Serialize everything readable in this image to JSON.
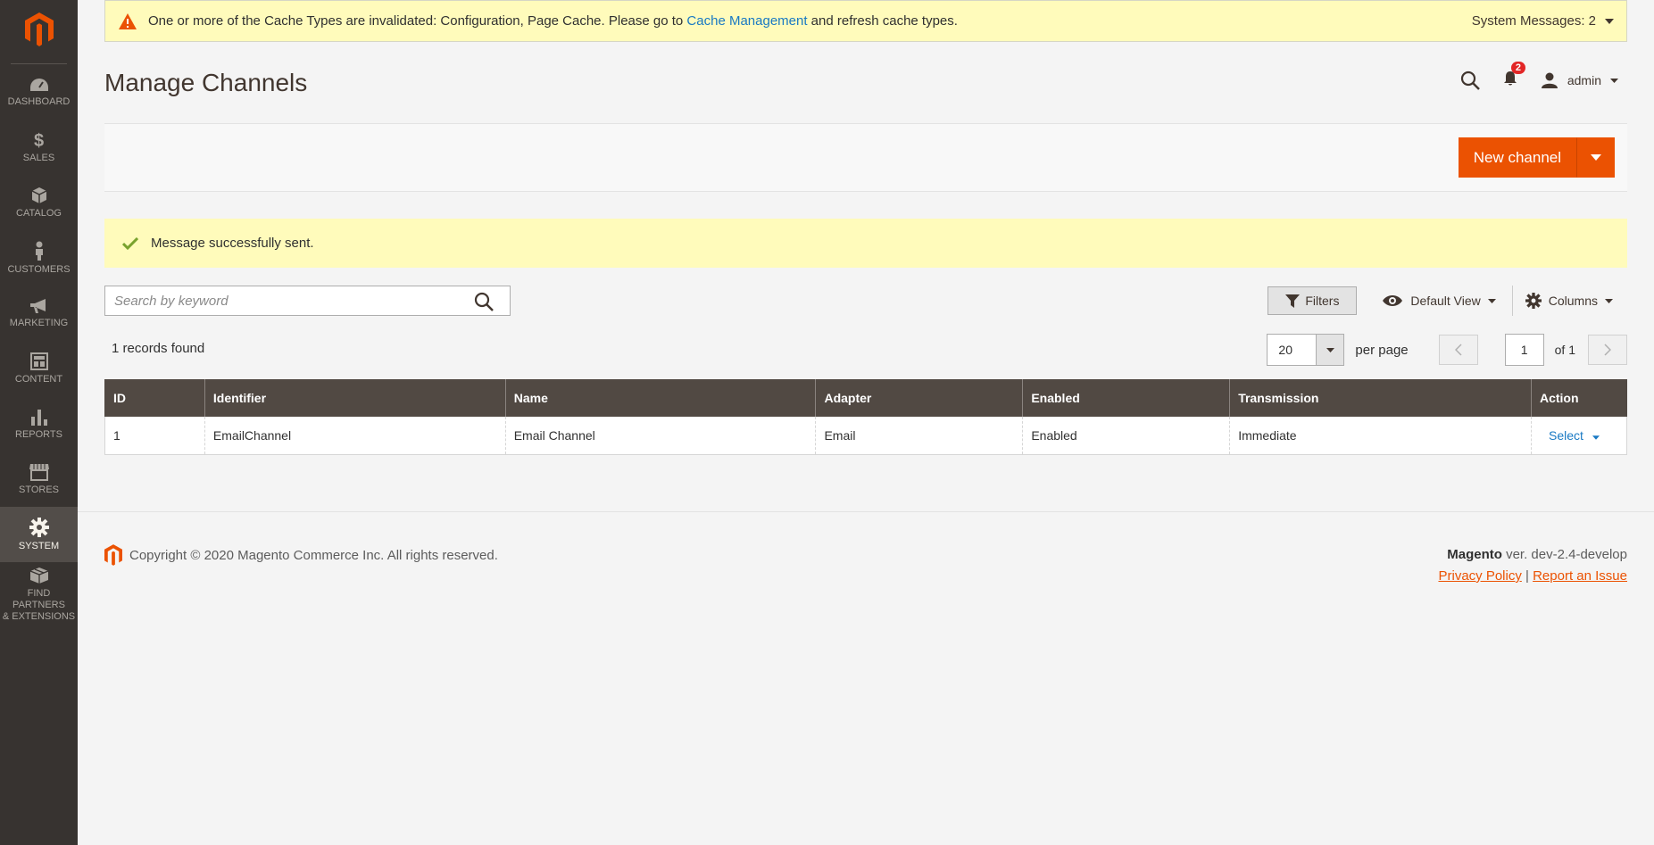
{
  "sidebar": {
    "items": [
      {
        "label": "DASHBOARD",
        "icon": "dashboard-icon"
      },
      {
        "label": "SALES",
        "icon": "dollar-icon"
      },
      {
        "label": "CATALOG",
        "icon": "box-icon"
      },
      {
        "label": "CUSTOMERS",
        "icon": "person-icon"
      },
      {
        "label": "MARKETING",
        "icon": "megaphone-icon"
      },
      {
        "label": "CONTENT",
        "icon": "layout-icon"
      },
      {
        "label": "REPORTS",
        "icon": "bar-chart-icon"
      },
      {
        "label": "STORES",
        "icon": "store-icon"
      },
      {
        "label": "SYSTEM",
        "icon": "gear-icon"
      },
      {
        "label_line1": "FIND PARTNERS",
        "label_line2": "& EXTENSIONS",
        "icon": "blocks-icon"
      }
    ]
  },
  "system_message": {
    "text_before": "One or more of the Cache Types are invalidated: Configuration, Page Cache. Please go to ",
    "link": "Cache Management",
    "text_after": " and refresh cache types.",
    "count_label": "System Messages: 2"
  },
  "header": {
    "title": "Manage Channels",
    "notification_count": "2",
    "user": "admin"
  },
  "actions": {
    "new_channel": "New channel"
  },
  "success_message": "Message successfully sent.",
  "toolbar": {
    "search_placeholder": "Search by keyword",
    "filters": "Filters",
    "view": "Default View",
    "columns": "Columns"
  },
  "pager": {
    "records": "1 records found",
    "per_page_value": "20",
    "per_page_label": "per page",
    "page": "1",
    "of_label": "of 1"
  },
  "grid": {
    "headers": [
      "ID",
      "Identifier",
      "Name",
      "Adapter",
      "Enabled",
      "Transmission",
      "Action"
    ],
    "rows": [
      {
        "id": "1",
        "identifier": "EmailChannel",
        "name": "Email Channel",
        "adapter": "Email",
        "enabled": "Enabled",
        "transmission": "Immediate",
        "action": "Select"
      }
    ]
  },
  "footer": {
    "copyright": "Copyright © 2020 Magento Commerce Inc. All rights reserved.",
    "brand": "Magento",
    "version": " ver. dev-2.4-develop",
    "privacy": "Privacy Policy",
    "separator": "|",
    "report": "Report an Issue"
  },
  "colors": {
    "accent": "#eb5202",
    "sidebar": "#373330",
    "table_header": "#514943",
    "message_bg": "#fffbbb",
    "link": "#1979c3"
  }
}
